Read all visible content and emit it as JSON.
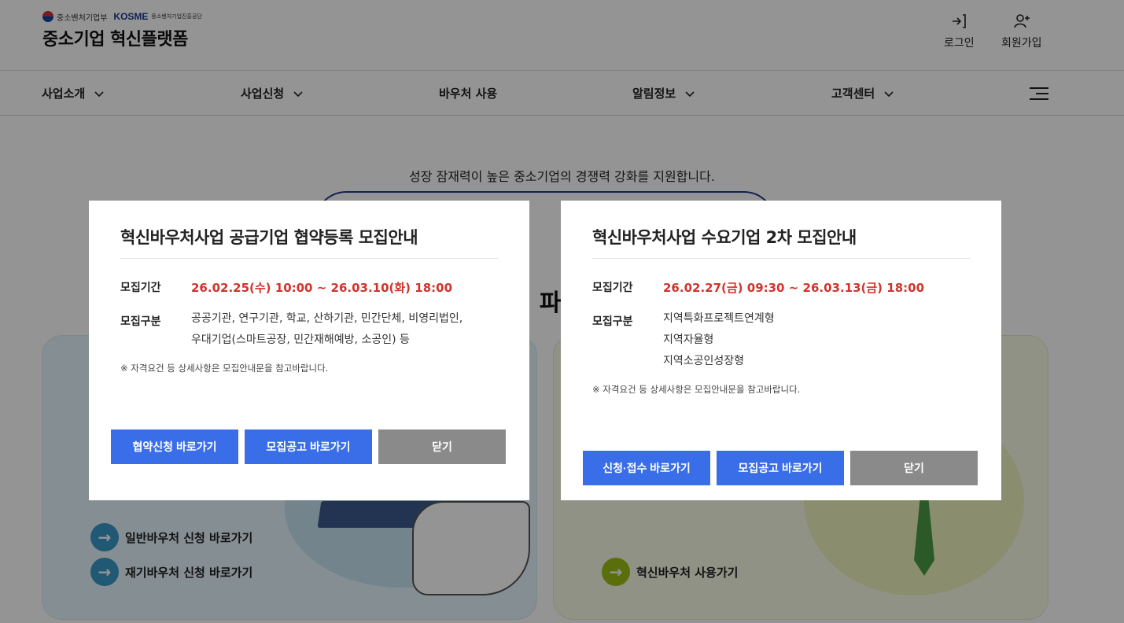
{
  "header": {
    "ministry": "중소벤처기업부",
    "kosme": "KOSME",
    "agency": "중소벤처기업진흥공단",
    "site_title": "중소기업 혁신플랫폼",
    "login": "로그인",
    "signup": "회원가입"
  },
  "nav": {
    "items": [
      {
        "label": "사업소개"
      },
      {
        "label": "사업신청"
      },
      {
        "label": "바우처 사용"
      },
      {
        "label": "알림정보"
      },
      {
        "label": "고객센터"
      }
    ]
  },
  "main": {
    "subtitle": "성장 잠재력이 높은 중소기업의 경쟁력 강화를 지원합니다.",
    "heading_fragment": "· 파",
    "left_card": {
      "link1": "일반바우처 신청 바로가기",
      "link2": "재기바우처 신청 바로가기"
    },
    "right_card": {
      "link1": "혁신바우처 사용가기"
    }
  },
  "popup1": {
    "title": "혁신바우처사업 공급기업 협약등록 모집안내",
    "period_label": "모집기간",
    "period": "26.02.25(수) 10:00 ~ 26.03.10(화) 18:00",
    "type_label": "모집구분",
    "types": [
      "공공기관, 연구기관, 학교, 산하기관, 민간단체, 비영리법인,",
      "우대기업(스마트공장, 민간재해예방, 소공인) 등"
    ],
    "note": "※ 자격요건 등 상세사항은 모집안내문을 참고바랍니다.",
    "btn1": "협약신청 바로가기",
    "btn2": "모집공고 바로가기",
    "btn3": "닫기"
  },
  "popup2": {
    "title": "혁신바우처사업 수요기업 2차 모집안내",
    "period_label": "모집기간",
    "period": "26.02.27(금) 09:30 ~ 26.03.13(금) 18:00",
    "type_label": "모집구분",
    "types": [
      "지역특화프로젝트연계형",
      "지역자율형",
      "지역소공인성장형"
    ],
    "note": "※ 자격요건 등 상세사항은 모집안내문을 참고바랍니다.",
    "btn1": "신청·접수 바로가기",
    "btn2": "모집공고 바로가기",
    "btn3": "닫기"
  },
  "colors": {
    "accent_blue": "#3a6ee8",
    "period_red": "#d0342c",
    "close_gray": "#8a8a8a"
  }
}
